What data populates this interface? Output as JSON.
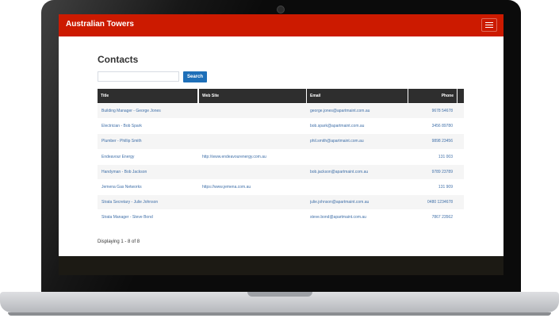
{
  "app": {
    "brand": "Australian Towers"
  },
  "page": {
    "title": "Contacts"
  },
  "search": {
    "value": "",
    "placeholder": "",
    "button_label": "Search"
  },
  "table": {
    "headers": {
      "title": "Title",
      "website": "Web Site",
      "email": "Email",
      "phone": "Phone"
    },
    "rows": [
      {
        "title": "Building Manager - George Jones",
        "website": "",
        "email": "george.jones@apartmaint.com.au",
        "phone": "9678 54678"
      },
      {
        "title": "Electrician - Bob Spark",
        "website": "",
        "email": "bob.spark@apartmaint.com.au",
        "phone": "3456 89780"
      },
      {
        "title": "Plumber - Phillip Smith",
        "website": "",
        "email": "phil.smith@apartmaint.com.au",
        "phone": "9898 23456"
      },
      {
        "title": "Endeavour Energy",
        "website": "http://www.endeavourenergy.com.au",
        "email": "",
        "phone": "131 003"
      },
      {
        "title": "Handyman - Bob Jackson",
        "website": "",
        "email": "bob.jackson@apartmaint.com.au",
        "phone": "9789 23789"
      },
      {
        "title": "Jemena Gas Networks",
        "website": "https://www.jemena.com.au",
        "email": "",
        "phone": "131 909"
      },
      {
        "title": "Strata Secretary - Julie Johnson",
        "website": "",
        "email": "julie.johnson@apartmaint.com.au",
        "phone": "0480 1234678"
      },
      {
        "title": "Strata Manager - Steve Bond",
        "website": "",
        "email": "steve.bond@apartmaint.com.au",
        "phone": "7867 23562"
      }
    ]
  },
  "pagination": {
    "text": "Displaying 1 - 8 of 8"
  },
  "colors": {
    "brand_red": "#cc1a00",
    "button_blue": "#1e6fb8",
    "header_dark": "#2e2e2e",
    "link_blue": "#3f6fa8"
  },
  "icons": {
    "menu": "hamburger-menu-icon",
    "camera": "camera-icon"
  }
}
